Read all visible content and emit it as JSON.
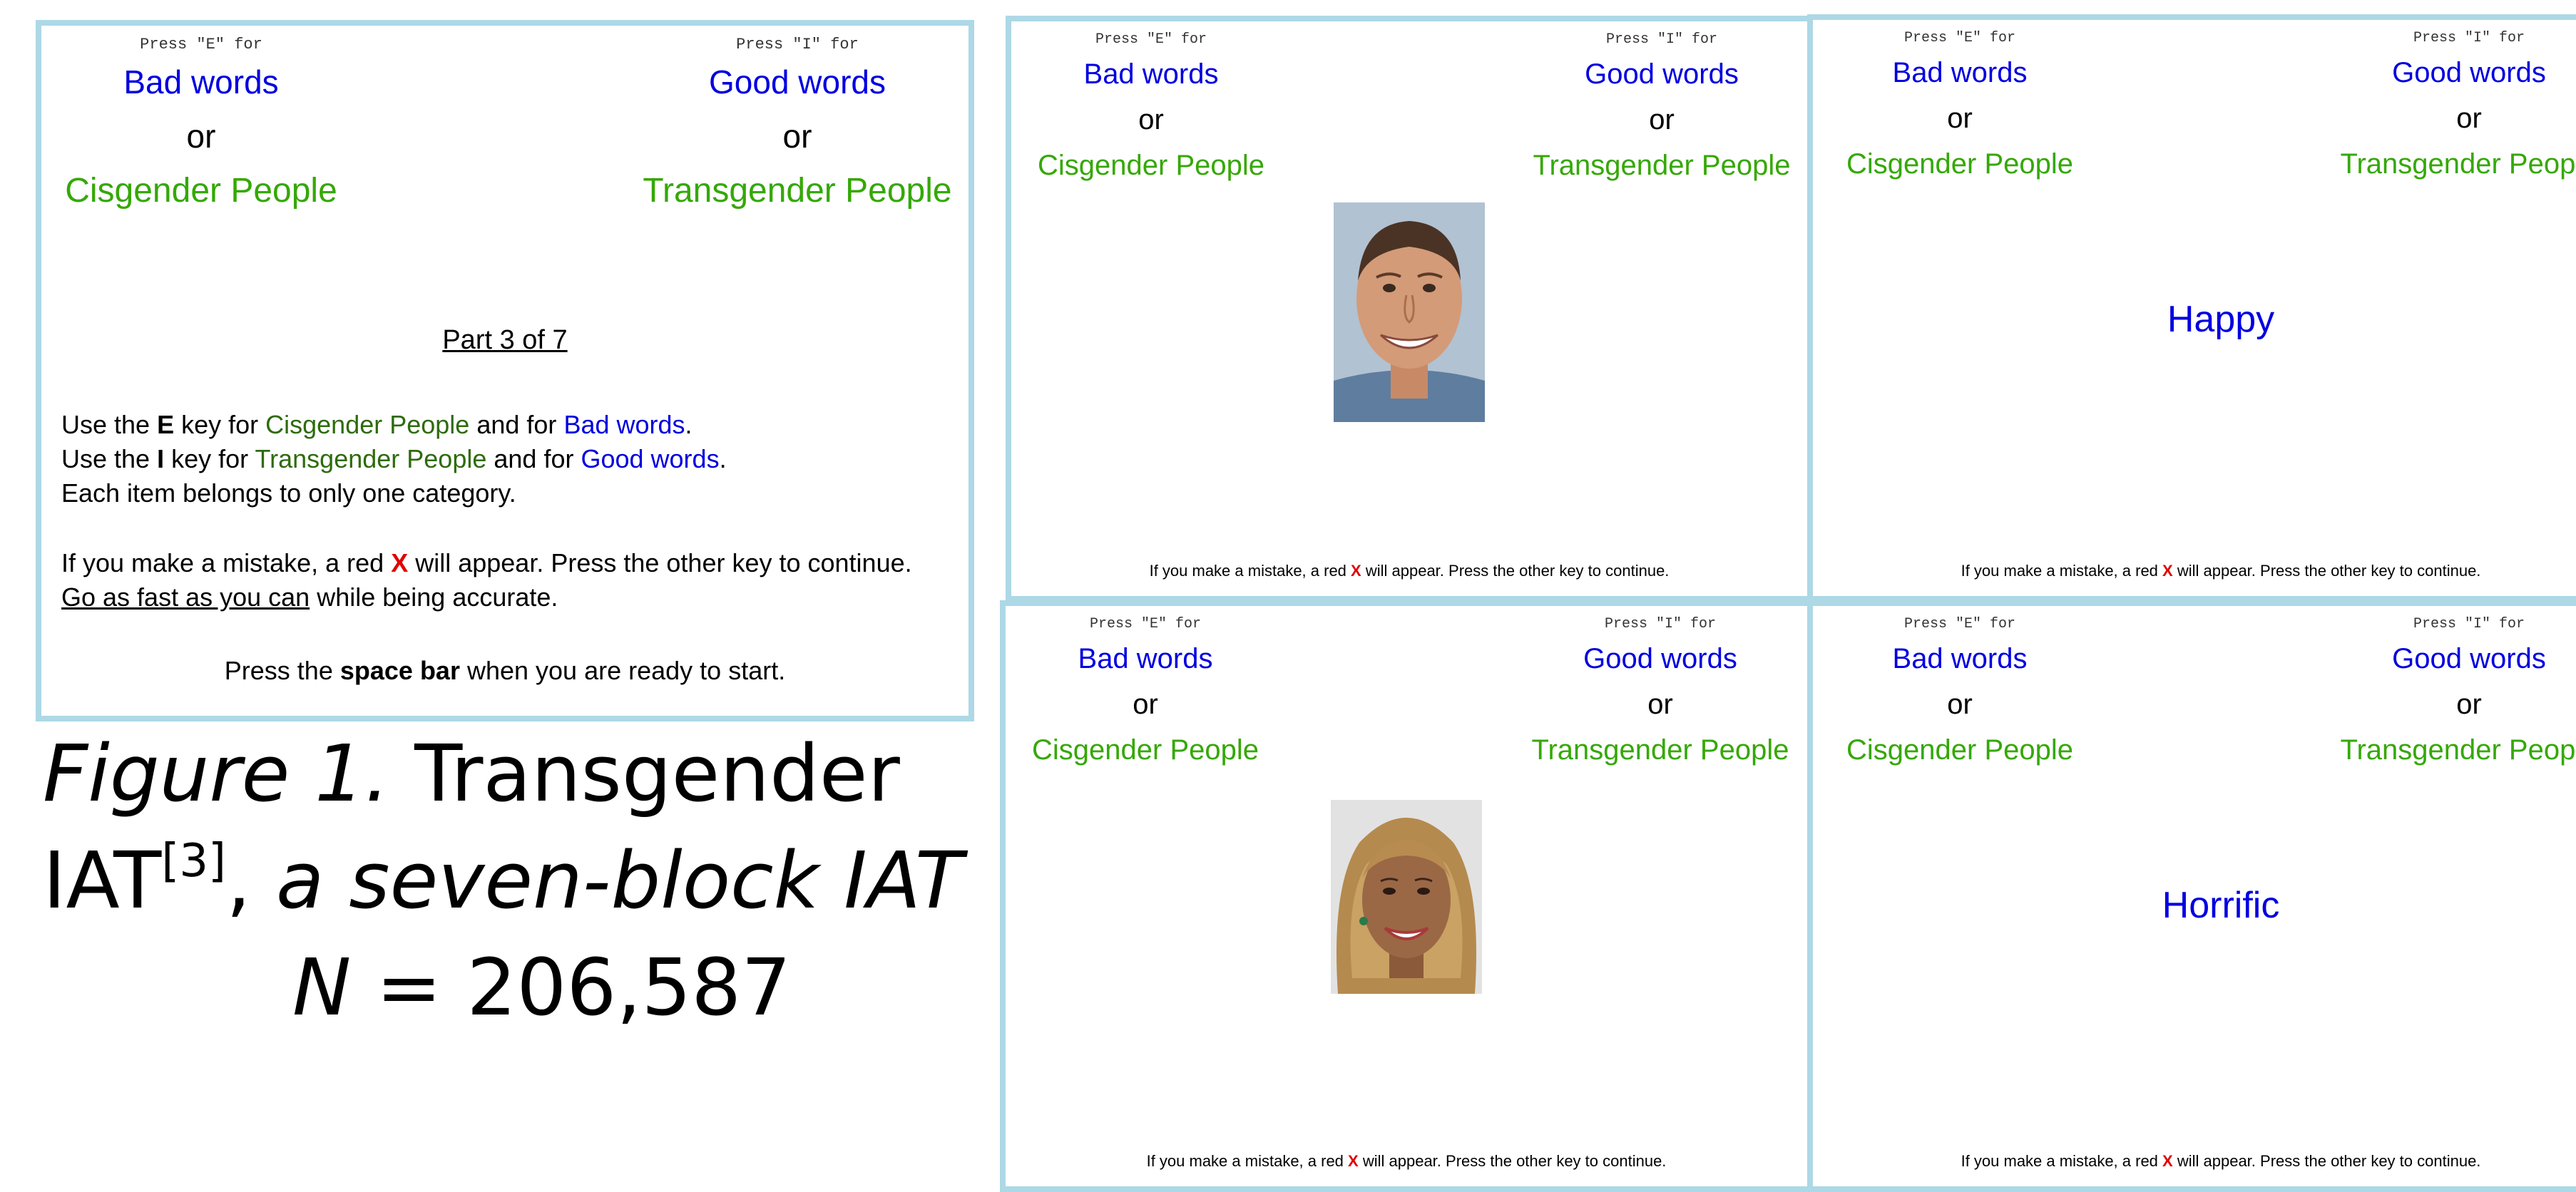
{
  "left_key_label": "Press \"E\" for",
  "right_key_label": "Press \"I\" for",
  "left_word_cat": "Bad words",
  "right_word_cat": "Good words",
  "or": "or",
  "left_group_cat": "Cisgender People",
  "right_group_cat": "Transgender People",
  "instructions": {
    "part": "Part 3 of 7",
    "l1_a": "Use the ",
    "l1_key": "E",
    "l1_b": " key for ",
    "l1_cat1": "Cisgender People",
    "l1_c": " and for ",
    "l1_cat2": "Bad words",
    "l1_d": ".",
    "l2_a": "Use the ",
    "l2_key": "I",
    "l2_b": " key for ",
    "l2_cat1": "Transgender People",
    "l2_c": " and for ",
    "l2_cat2": "Good words",
    "l2_d": ".",
    "l3": "Each item belongs to only one category.",
    "m_a": "If you make a mistake, a red ",
    "m_x": "X",
    "m_b": " will appear. Press the other key to continue.",
    "fast_u": "Go as fast as you can",
    "fast_b": " while being accurate.",
    "start_a": "Press the ",
    "start_bold": "space bar",
    "start_b": " when you are ready to start."
  },
  "mistake_a": "If you make a mistake, a red ",
  "mistake_x": "X",
  "mistake_b": " will appear. Press the other key to continue.",
  "stimuli": {
    "word_top": "Happy",
    "word_bottom": "Horrific"
  },
  "caption": {
    "fig": "Figure 1.",
    "title1": " Transgender",
    "title2": "IAT",
    "ref": "[3]",
    "comma": ", ",
    "sub": "a seven-block IAT",
    "n_label": "N",
    "n_value": " = 206,587"
  },
  "colors": {
    "border": "#add8e6",
    "word_cat": "#0000e0",
    "group_cat": "#35a806",
    "mistake_x": "#e00000"
  }
}
